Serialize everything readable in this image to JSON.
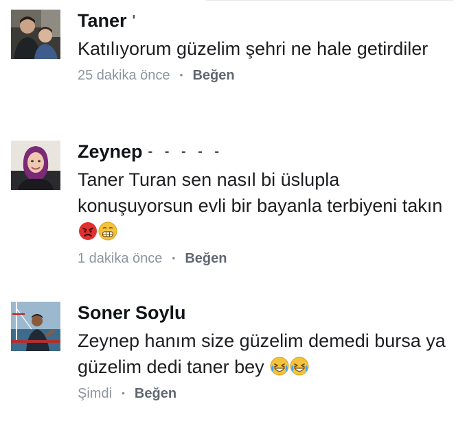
{
  "comments": [
    {
      "author": "Taner",
      "author_suffix": "'",
      "text": "Katılıyorum güzelim şehri ne hale getirdiler",
      "time": "25 dakika önce",
      "like_label": "Beğen",
      "emojis": [],
      "avatar_icon": "profile-photo-man-with-child"
    },
    {
      "author": "Zeynep",
      "author_suffix": "- -  - - -",
      "text": "Taner Turan sen nasıl bi üslupla konuşuyorsun evli bir bayanla terbiyeni takın",
      "time": "1 dakika önce",
      "like_label": "Beğen",
      "emojis": [
        "angry-face-emoji",
        "grimacing-face-emoji"
      ],
      "avatar_icon": "profile-photo-woman-headscarf"
    },
    {
      "author": "Soner Soylu",
      "author_suffix": "",
      "text": "Zeynep hanım size güzelim demedi bursa ya güzelim dedi taner bey",
      "time": "Şimdi",
      "like_label": "Beğen",
      "emojis": [
        "laughing-tears-emoji",
        "laughing-tears-emoji"
      ],
      "avatar_icon": "profile-photo-man-on-boat"
    }
  ],
  "separator": "•",
  "colors": {
    "author": "#111418",
    "text": "#1c1e21",
    "meta": "#8d949e",
    "like": "#606770",
    "angry_emoji": "#e0302f",
    "emoji_yellow": "#f5c33b"
  }
}
